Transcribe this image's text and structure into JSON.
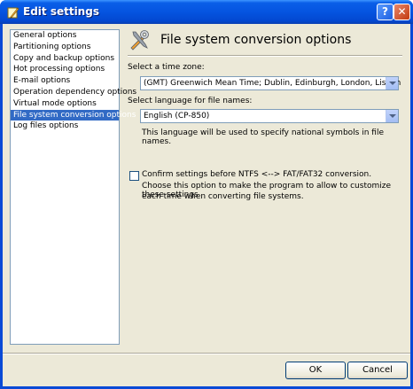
{
  "window": {
    "title": "Edit settings",
    "help_glyph": "?",
    "close_glyph": "✕"
  },
  "sidebar": {
    "items": [
      {
        "label": "General options"
      },
      {
        "label": "Partitioning options"
      },
      {
        "label": "Copy and backup options"
      },
      {
        "label": "Hot processing options"
      },
      {
        "label": "E-mail options"
      },
      {
        "label": "Operation dependency options"
      },
      {
        "label": "Virtual mode options"
      },
      {
        "label": "File system conversion options"
      },
      {
        "label": "Log files options"
      }
    ],
    "selected_index": 7
  },
  "panel": {
    "title": "File system conversion options",
    "header_icon": "tools-icon",
    "time_zone_label": "Select a time zone:",
    "time_zone_value": "(GMT) Greenwich Mean Time; Dublin, Edinburgh, London, Lisbon",
    "language_label": "Select language for file names:",
    "language_value": "English (CP-850)",
    "language_hint": "This language will be used to specify national symbols in file names.",
    "confirm_label": "Confirm settings before NTFS <--> FAT/FAT32 conversion.",
    "confirm_checked": false,
    "confirm_hint_line1": "Choose this option to make the program to allow to customize these settings",
    "confirm_hint_line2": "each time when converting file systems."
  },
  "buttons": {
    "ok": "OK",
    "cancel": "Cancel"
  },
  "colors": {
    "selection": "#316ac5",
    "titlebar": "#0554e0",
    "dialog_bg": "#ece9d8"
  }
}
